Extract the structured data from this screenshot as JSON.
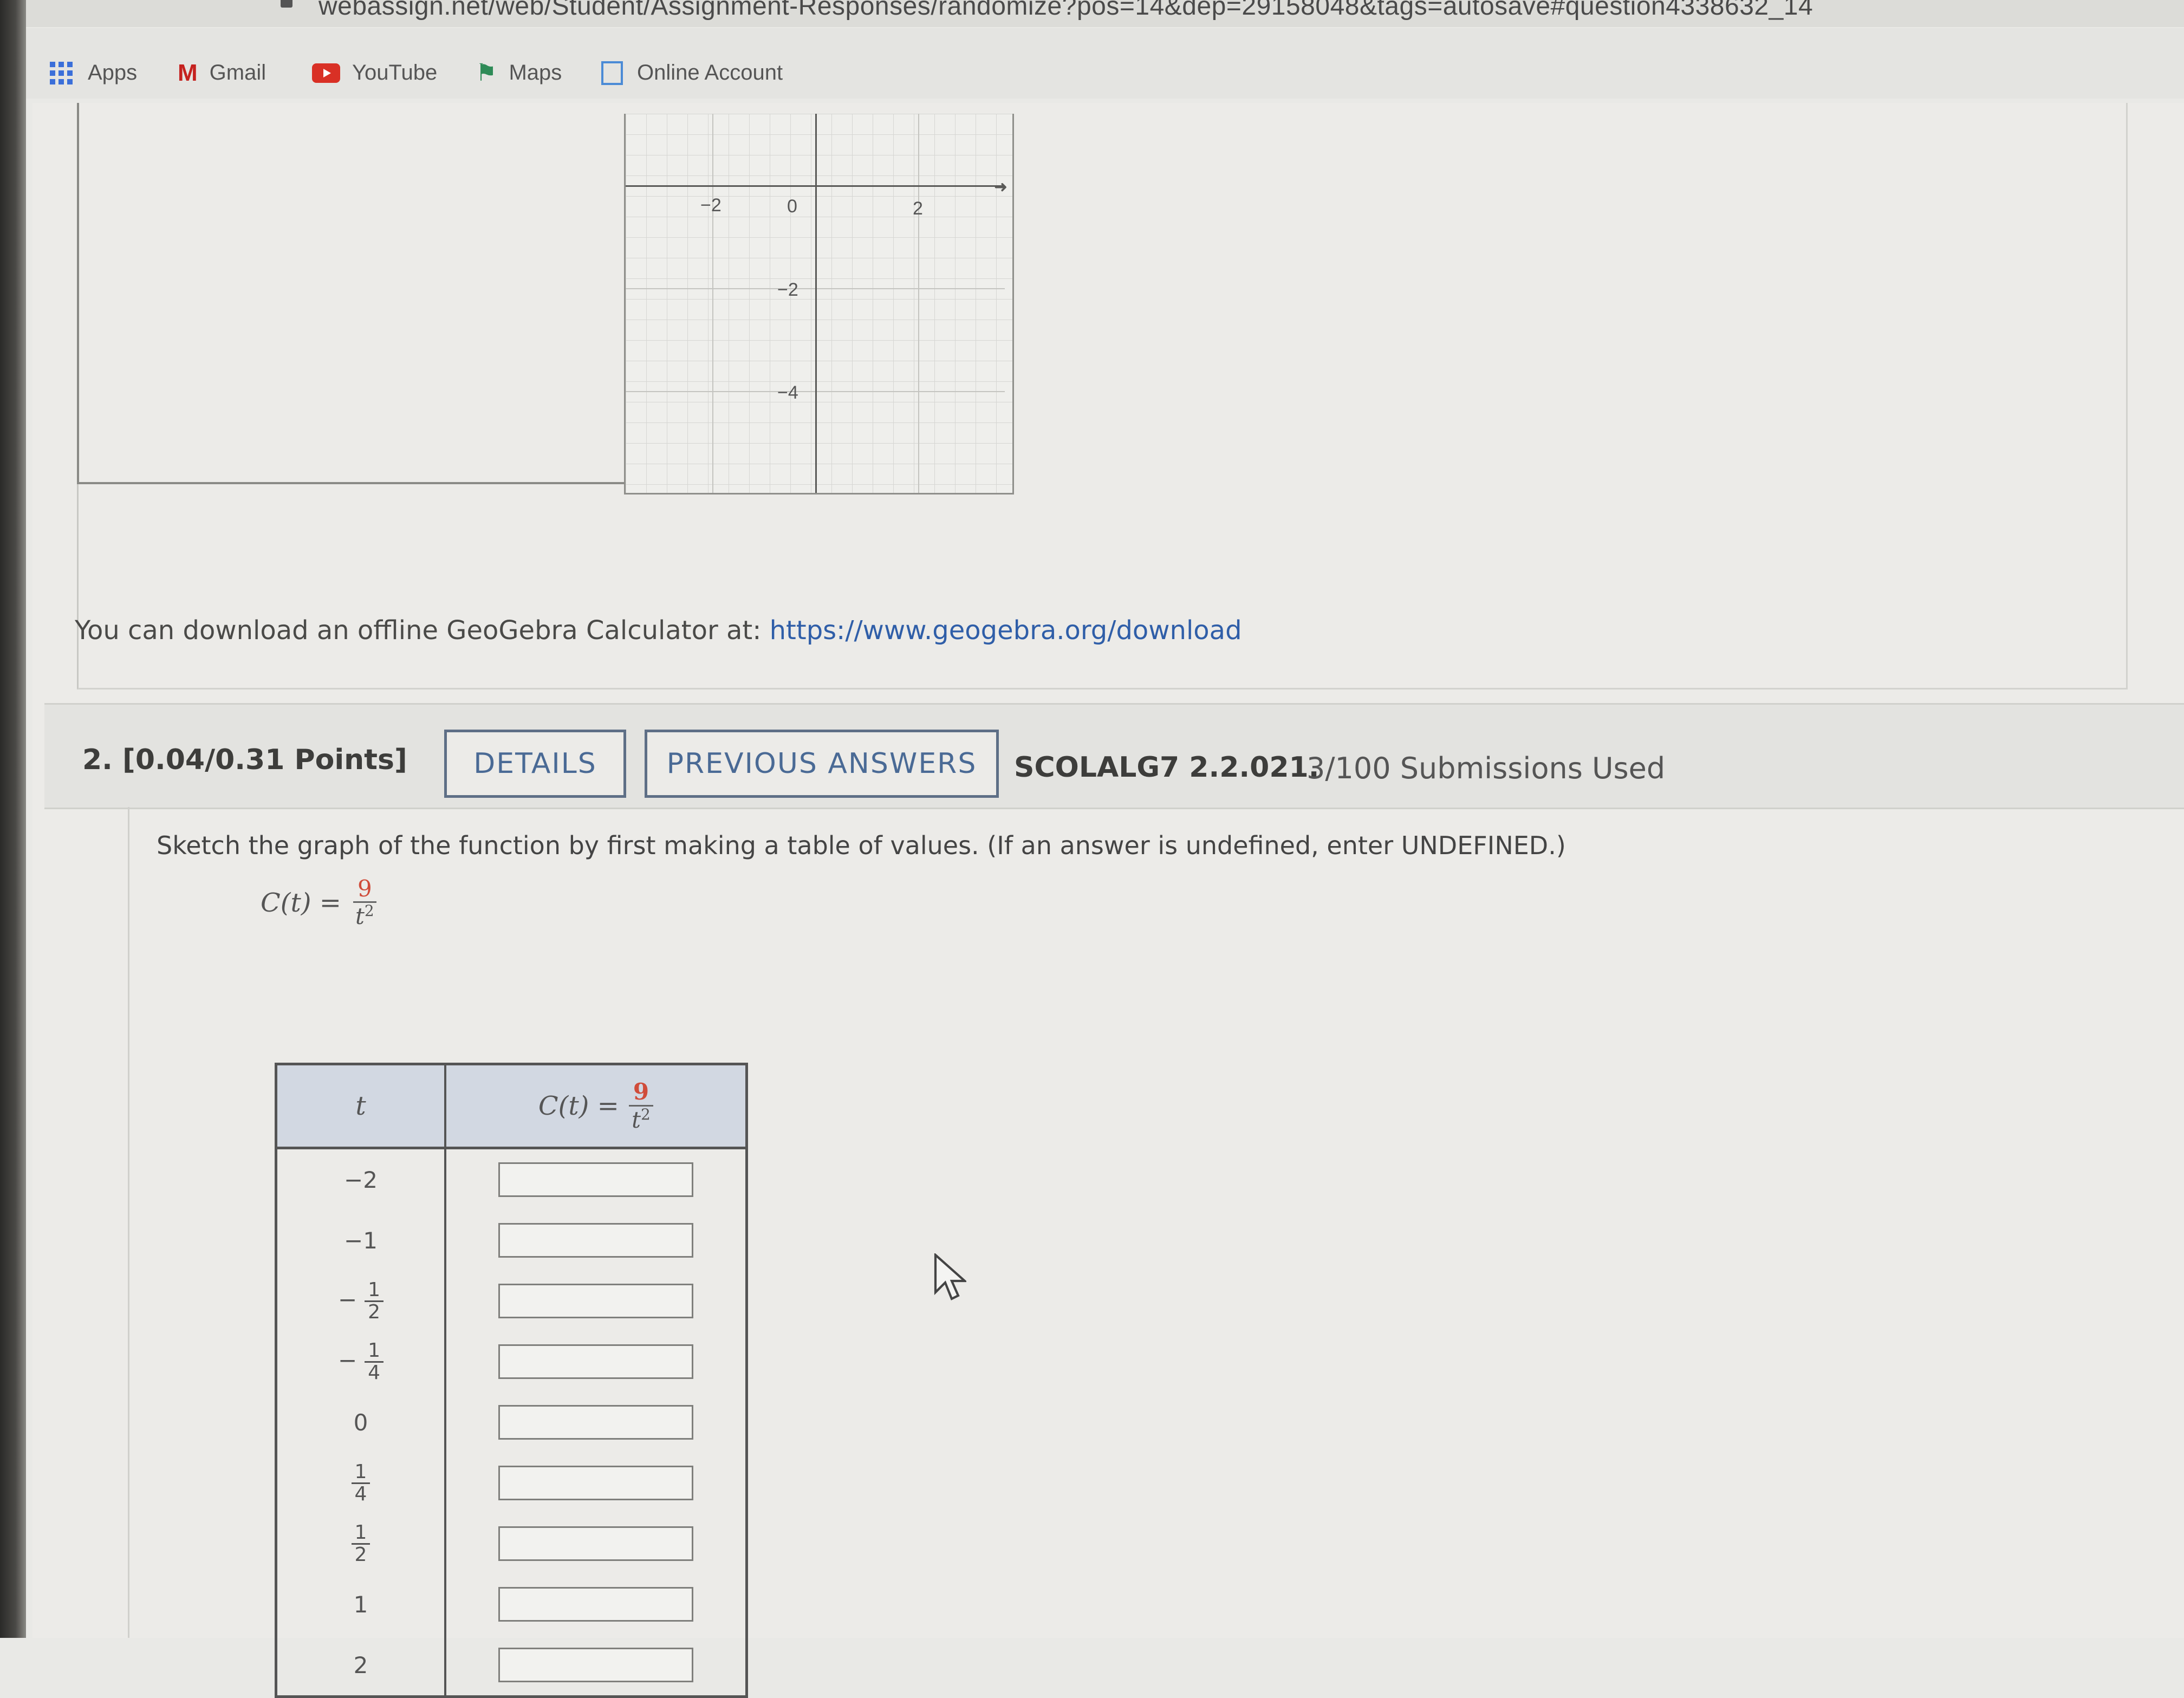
{
  "browser": {
    "url": "webassign.net/web/Student/Assignment-Responses/randomize?pos=14&dep=29158048&tags=autosave#question4338632_14",
    "bookmarks": [
      {
        "label": "Apps",
        "icon": "apps-grid-icon"
      },
      {
        "label": "Gmail",
        "icon": "gmail-icon"
      },
      {
        "label": "YouTube",
        "icon": "youtube-icon"
      },
      {
        "label": "Maps",
        "icon": "maps-icon"
      },
      {
        "label": "Online Account",
        "icon": "page-icon"
      }
    ]
  },
  "question1": {
    "graph_ticks": {
      "x_neg2": "−2",
      "x_0": "0",
      "x_2": "2",
      "y_neg2": "−2",
      "y_neg4": "−4"
    },
    "download_text": "You can download an offline GeoGebra Calculator at: ",
    "download_link": "https://www.geogebra.org/download"
  },
  "question2": {
    "number": "2.",
    "points": "[0.04/0.31 Points]",
    "details_button": "DETAILS",
    "previous_answers_button": "PREVIOUS ANSWERS",
    "code": "SCOLALG7 2.2.021.",
    "submissions": "3/100 Submissions Used",
    "instructions": "Sketch the graph of the function by first making a table of values. (If an answer is undefined, enter UNDEFINED.)",
    "function_lhs": "C(t) =",
    "function_numerator": "9",
    "function_denominator": "t",
    "function_exponent": "2",
    "table": {
      "header_t": "t",
      "header_c_lhs": "C(t) =",
      "header_c_num": "9",
      "header_c_den": "t",
      "header_c_exp": "2",
      "rows": [
        {
          "t_sign": "",
          "t_whole": "−2",
          "t_num": "",
          "t_den": "",
          "value": ""
        },
        {
          "t_sign": "",
          "t_whole": "−1",
          "t_num": "",
          "t_den": "",
          "value": ""
        },
        {
          "t_sign": "−",
          "t_whole": "",
          "t_num": "1",
          "t_den": "2",
          "value": ""
        },
        {
          "t_sign": "−",
          "t_whole": "",
          "t_num": "1",
          "t_den": "4",
          "value": ""
        },
        {
          "t_sign": "",
          "t_whole": "0",
          "t_num": "",
          "t_den": "",
          "value": ""
        },
        {
          "t_sign": "",
          "t_whole": "",
          "t_num": "1",
          "t_den": "4",
          "value": ""
        },
        {
          "t_sign": "",
          "t_whole": "",
          "t_num": "1",
          "t_den": "2",
          "value": ""
        },
        {
          "t_sign": "",
          "t_whole": "1",
          "t_num": "",
          "t_den": "",
          "value": ""
        },
        {
          "t_sign": "",
          "t_whole": "2",
          "t_num": "",
          "t_den": "",
          "value": ""
        }
      ]
    }
  },
  "colors": {
    "link": "#2f5ea8",
    "button_border": "#5e6f86",
    "button_text": "#4a6a95",
    "fraction_numerator": "#d04c3a",
    "table_header_bg": "#d2d8e2"
  }
}
